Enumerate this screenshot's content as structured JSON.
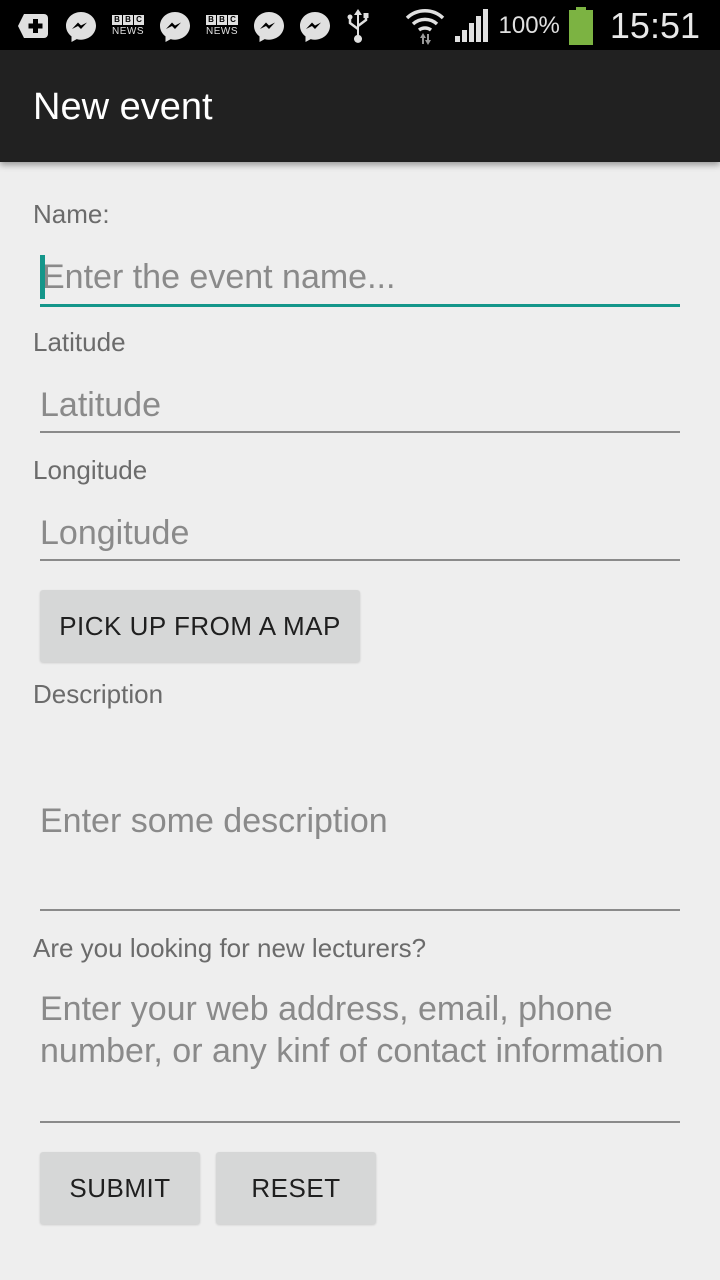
{
  "status_bar": {
    "left_icons": [
      "add-box-icon",
      "messenger-icon",
      "bbc-news-icon",
      "messenger-icon",
      "bbc-news-icon",
      "messenger-icon",
      "messenger-icon",
      "usb-icon"
    ],
    "bbc_label_top": "BBC",
    "bbc_label_bottom": "NEWS",
    "battery_percent": "100%",
    "battery_color": "#7cb342",
    "time": "15:51"
  },
  "app_bar": {
    "title": "New event"
  },
  "form": {
    "name": {
      "label": "Name:",
      "placeholder": "Enter the event name..."
    },
    "latitude": {
      "label": "Latitude",
      "placeholder": "Latitude"
    },
    "longitude": {
      "label": "Longitude",
      "placeholder": "Longitude"
    },
    "pick_map_label": "PICK UP FROM A MAP",
    "description": {
      "label": "Description",
      "placeholder": "Enter some description"
    },
    "lecturers": {
      "label": "Are you looking for new lecturers?",
      "placeholder": "Enter your web address, email, phone number, or any kinf of contact information"
    },
    "submit_label": "SUBMIT",
    "reset_label": "RESET"
  },
  "colors": {
    "accent": "#14968a",
    "app_bar": "#212121",
    "background": "#eeeeee",
    "button": "#d6d7d7"
  }
}
